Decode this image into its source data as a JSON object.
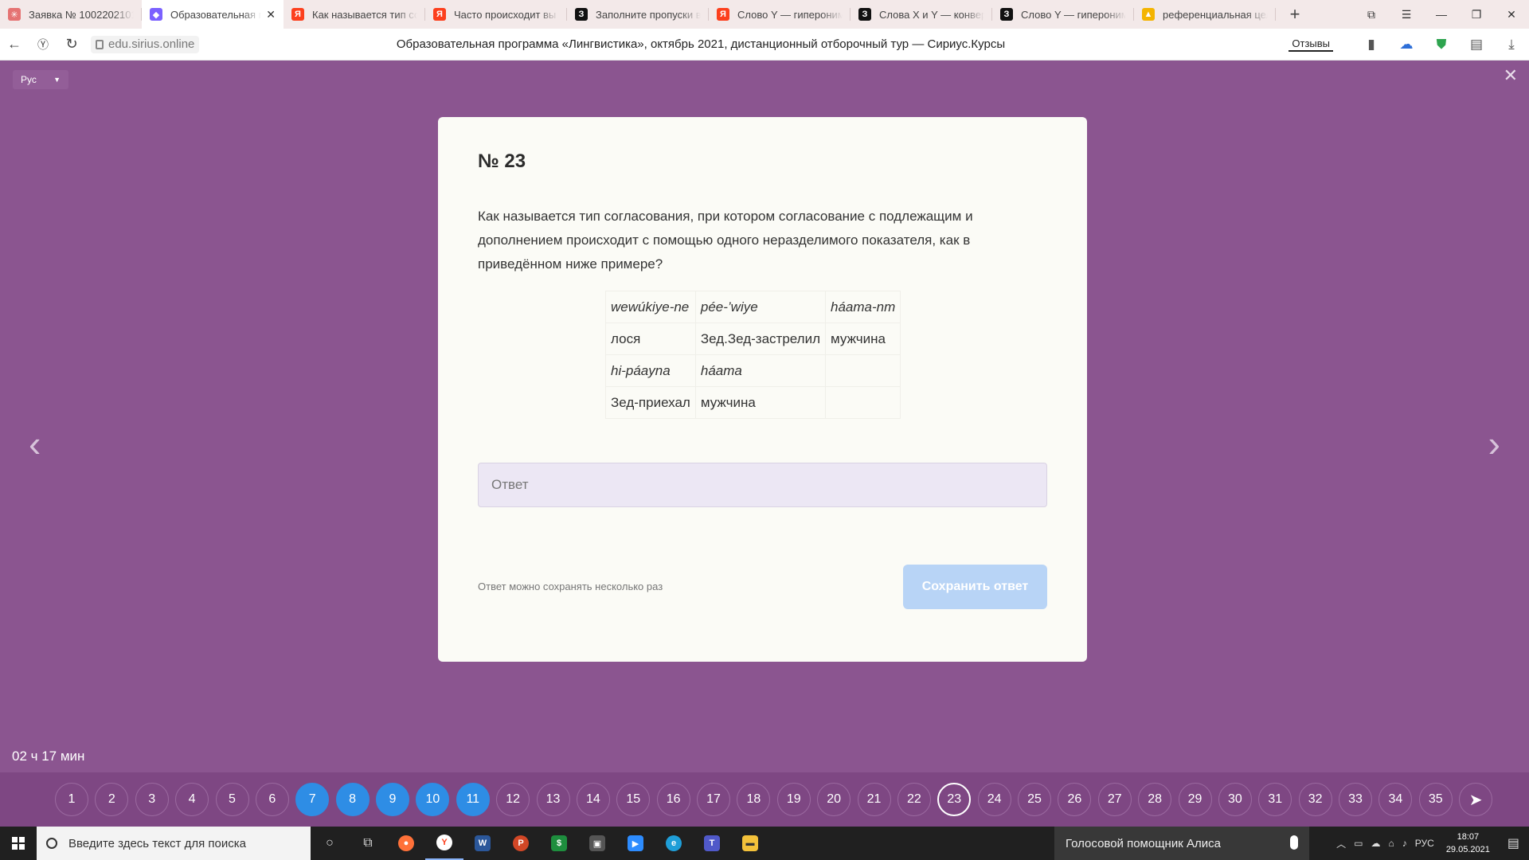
{
  "browser": {
    "tabs": [
      {
        "title": "Заявка № 1002202101",
        "icon": "sirius-icon",
        "color": "#e57373",
        "glyph": "✳",
        "active": false
      },
      {
        "title": "Образовательная п",
        "icon": "sirius-logo-icon",
        "color": "#7b61ff",
        "glyph": "◆",
        "active": true
      },
      {
        "title": "Как называется тип со",
        "icon": "yandex-icon",
        "color": "#fc3f1d",
        "glyph": "Я",
        "active": false
      },
      {
        "title": "Часто происходит вы",
        "icon": "yandex-icon",
        "color": "#fc3f1d",
        "glyph": "Я",
        "active": false
      },
      {
        "title": "Заполните пропуски в",
        "icon": "znanija-icon",
        "color": "#111111",
        "glyph": "З",
        "active": false
      },
      {
        "title": "Слово Y — гипероним",
        "icon": "yandex-icon",
        "color": "#fc3f1d",
        "glyph": "Я",
        "active": false
      },
      {
        "title": "Слова X и Y — конвер",
        "icon": "znanija-icon",
        "color": "#111111",
        "glyph": "З",
        "active": false
      },
      {
        "title": "Слово Y — гипероним",
        "icon": "znanija-icon",
        "color": "#111111",
        "glyph": "З",
        "active": false
      },
      {
        "title": "референциальная цел",
        "icon": "image-icon",
        "color": "#f4b400",
        "glyph": "▲",
        "active": false
      }
    ],
    "url": "edu.sirius.online",
    "page_title": "Образовательная программа «Лингвистика», октябрь 2021, дистанционный отборочный тур — Сириус.Курсы",
    "reviews_label": "Отзывы"
  },
  "page": {
    "language": "Рус",
    "task_number": "№ 23",
    "question": "Как называется тип согласования, при котором согласование с подлежащим и дополнением происходит с помощью одного неразделимого показателя, как в приведённом ниже примере?",
    "gloss": [
      [
        "wewúkiye-ne",
        "pée-’wiye",
        "háama-nm"
      ],
      [
        "лося",
        "Зед.Зед-застрелил",
        "мужчина"
      ],
      [
        "hi-páayna",
        "háama",
        ""
      ],
      [
        "Зед-приехал",
        "мужчина",
        ""
      ]
    ],
    "answer_placeholder": "Ответ",
    "save_hint": "Ответ можно сохранять несколько раз",
    "save_button": "Сохранить ответ",
    "timer": "02 ч 17 мин"
  },
  "question_nav": {
    "questions": [
      "1",
      "2",
      "3",
      "4",
      "5",
      "6",
      "7",
      "8",
      "9",
      "10",
      "11",
      "12",
      "13",
      "14",
      "15",
      "16",
      "17",
      "18",
      "19",
      "20",
      "21",
      "22",
      "23",
      "24",
      "25",
      "26",
      "27",
      "28",
      "29",
      "30",
      "31",
      "32",
      "33",
      "34",
      "35"
    ],
    "answered": [
      "7",
      "8",
      "9",
      "10",
      "11"
    ],
    "current": "23",
    "send_icon": "send-icon"
  },
  "taskbar": {
    "search_placeholder": "Введите здесь текст для поиска",
    "assistant_label": "Голосовой помощник Алиса",
    "language": "РУС",
    "time": "18:07",
    "date": "29.05.2021"
  }
}
